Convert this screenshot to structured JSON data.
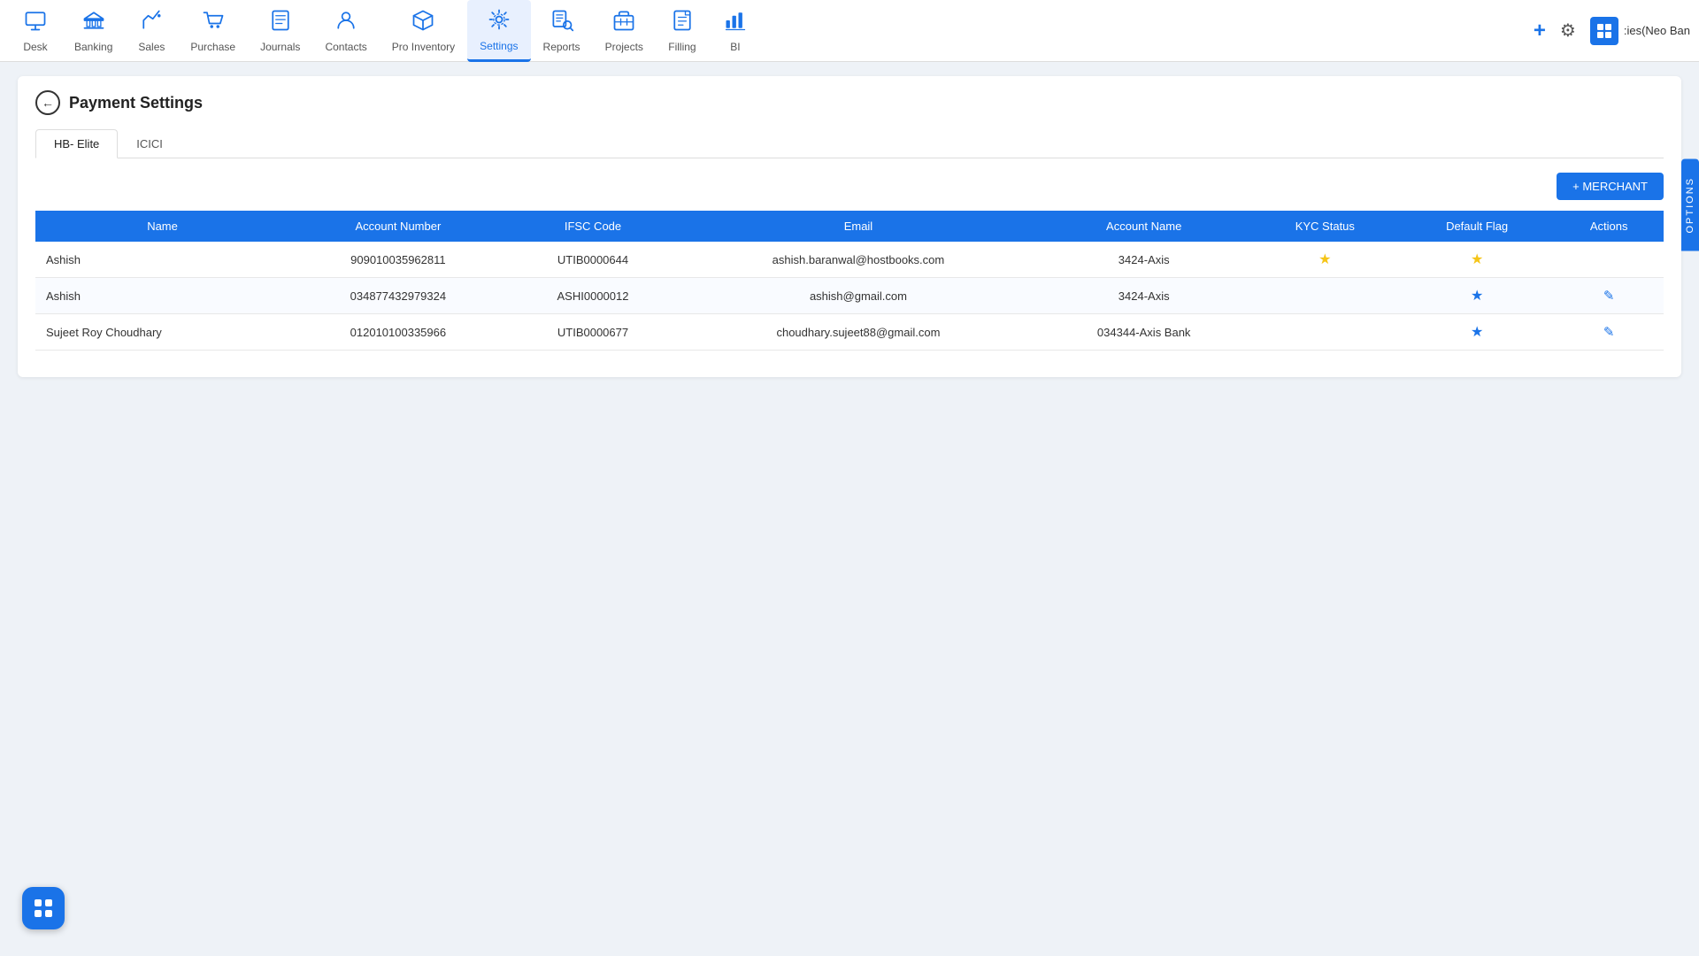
{
  "nav": {
    "items": [
      {
        "id": "desk",
        "label": "Desk",
        "icon": "🖥"
      },
      {
        "id": "banking",
        "label": "Banking",
        "icon": "🏦"
      },
      {
        "id": "sales",
        "label": "Sales",
        "icon": "📊"
      },
      {
        "id": "purchase",
        "label": "Purchase",
        "icon": "🛒"
      },
      {
        "id": "journals",
        "label": "Journals",
        "icon": "📓"
      },
      {
        "id": "contacts",
        "label": "Contacts",
        "icon": "👥"
      },
      {
        "id": "pro-inventory",
        "label": "Pro Inventory",
        "icon": "📦"
      },
      {
        "id": "settings",
        "label": "Settings",
        "icon": "⚙"
      },
      {
        "id": "reports",
        "label": "Reports",
        "icon": "📈"
      },
      {
        "id": "projects",
        "label": "Projects",
        "icon": "🗂"
      },
      {
        "id": "filling",
        "label": "Filling",
        "icon": "📋"
      },
      {
        "id": "bi",
        "label": "BI",
        "icon": "📉"
      }
    ],
    "active": "settings",
    "user_label": ":ies(Neo Ban",
    "options_label": "OPTIONS"
  },
  "page": {
    "title": "Payment Settings",
    "back_label": "‹"
  },
  "tabs": [
    {
      "id": "hb-elite",
      "label": "HB- Elite",
      "active": true
    },
    {
      "id": "icici",
      "label": "ICICI",
      "active": false
    }
  ],
  "merchant_btn": "+ MERCHANT",
  "table": {
    "columns": [
      "Name",
      "Account Number",
      "IFSC Code",
      "Email",
      "Account Name",
      "KYC Status",
      "Default Flag",
      "Actions"
    ],
    "rows": [
      {
        "name": "Ashish",
        "account_number": "909010035962811",
        "ifsc_code": "UTIB0000644",
        "email": "ashish.baranwal@hostbooks.com",
        "account_name": "3424-Axis",
        "kyc_status": "star_gold",
        "default_flag": "star_gold",
        "has_edit": false
      },
      {
        "name": "Ashish",
        "account_number": "034877432979324",
        "ifsc_code": "ASHI0000012",
        "email": "ashish@gmail.com",
        "account_name": "3424-Axis",
        "kyc_status": "",
        "default_flag": "star_blue",
        "has_edit": true
      },
      {
        "name": "Sujeet Roy Choudhary",
        "account_number": "012010100335966",
        "ifsc_code": "UTIB0000677",
        "email": "choudhary.sujeet88@gmail.com",
        "account_name": "034344-Axis Bank",
        "kyc_status": "",
        "default_flag": "star_blue",
        "has_edit": true
      }
    ]
  }
}
